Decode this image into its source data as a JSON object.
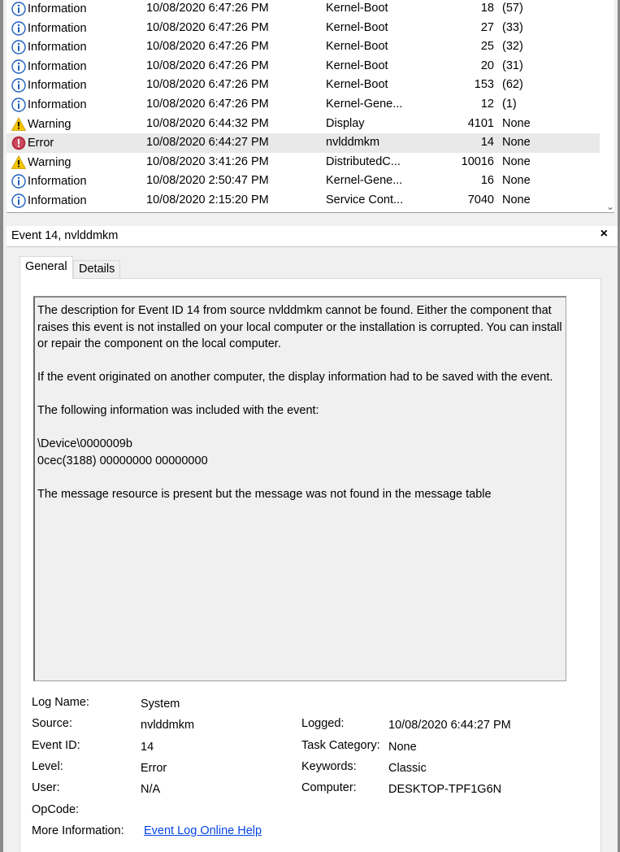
{
  "events": [
    {
      "level": "Information",
      "icon": "info",
      "date": "10/08/2020 6:47:26 PM",
      "source": "Kernel-Boot",
      "id": "18",
      "task": "(57)"
    },
    {
      "level": "Information",
      "icon": "info",
      "date": "10/08/2020 6:47:26 PM",
      "source": "Kernel-Boot",
      "id": "27",
      "task": "(33)"
    },
    {
      "level": "Information",
      "icon": "info",
      "date": "10/08/2020 6:47:26 PM",
      "source": "Kernel-Boot",
      "id": "25",
      "task": "(32)"
    },
    {
      "level": "Information",
      "icon": "info",
      "date": "10/08/2020 6:47:26 PM",
      "source": "Kernel-Boot",
      "id": "20",
      "task": "(31)"
    },
    {
      "level": "Information",
      "icon": "info",
      "date": "10/08/2020 6:47:26 PM",
      "source": "Kernel-Boot",
      "id": "153",
      "task": "(62)"
    },
    {
      "level": "Information",
      "icon": "info",
      "date": "10/08/2020 6:47:26 PM",
      "source": "Kernel-Gene...",
      "id": "12",
      "task": "(1)"
    },
    {
      "level": "Warning",
      "icon": "warning",
      "date": "10/08/2020 6:44:32 PM",
      "source": "Display",
      "id": "4101",
      "task": "None"
    },
    {
      "level": "Error",
      "icon": "error",
      "date": "10/08/2020 6:44:27 PM",
      "source": "nvlddmkm",
      "id": "14",
      "task": "None",
      "selected": true
    },
    {
      "level": "Warning",
      "icon": "warning",
      "date": "10/08/2020 3:41:26 PM",
      "source": "DistributedC...",
      "id": "10016",
      "task": "None"
    },
    {
      "level": "Information",
      "icon": "info",
      "date": "10/08/2020 2:50:47 PM",
      "source": "Kernel-Gene...",
      "id": "16",
      "task": "None"
    },
    {
      "level": "Information",
      "icon": "info",
      "date": "10/08/2020 2:15:20 PM",
      "source": "Service Cont...",
      "id": "7040",
      "task": "None"
    }
  ],
  "detail": {
    "title": "Event 14, nvlddmkm",
    "close": "×",
    "tabs": {
      "general": "General",
      "details": "Details"
    },
    "description": {
      "p1": "The description for Event ID 14 from source nvlddmkm cannot be found. Either the component that raises this event is not installed on your local computer or the installation is corrupted. You can install or repair the component on the local computer.",
      "p2": "If the event originated on another computer, the display information had to be saved with the event.",
      "p3": "The following information was included with the event:",
      "p4_line1": "\\Device\\0000009b",
      "p4_line2": "0cec(3188) 00000000 00000000",
      "p5": "The message resource is present but the message was not found in the message table"
    },
    "properties": {
      "log_name_label": "Log Name:",
      "log_name": "System",
      "source_label": "Source:",
      "source": "nvlddmkm",
      "logged_label": "Logged:",
      "logged": "10/08/2020 6:44:27 PM",
      "event_id_label": "Event ID:",
      "event_id": "14",
      "task_category_label": "Task Category:",
      "task_category": "None",
      "level_label": "Level:",
      "level": "Error",
      "keywords_label": "Keywords:",
      "keywords": "Classic",
      "user_label": "User:",
      "user": "N/A",
      "computer_label": "Computer:",
      "computer": "DESKTOP-TPF1G6N",
      "opcode_label": "OpCode:",
      "more_info_label": "More Information:",
      "more_info_link": "Event Log Online Help"
    }
  },
  "colors": {
    "link": "#0645e6",
    "info": "#1f5fbf",
    "warning": "#f5c400",
    "error": "#b3283c",
    "selected_row": "#e9e9e9"
  }
}
